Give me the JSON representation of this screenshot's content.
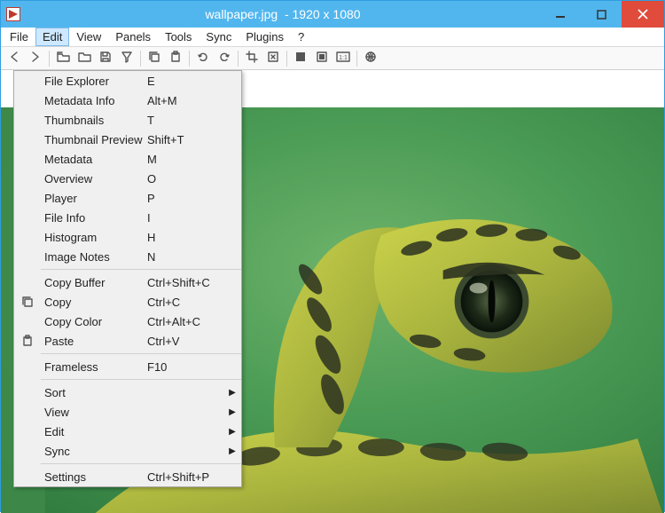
{
  "window": {
    "title": "wallpaper.jpg  - 1920 x 1080"
  },
  "menubar": {
    "items": [
      "File",
      "Edit",
      "View",
      "Panels",
      "Tools",
      "Sync",
      "Plugins",
      "?"
    ],
    "active_index": 1
  },
  "toolbar": {
    "icons": [
      "nav-back-icon",
      "nav-forward-icon",
      "sep",
      "folder-open-icon",
      "folder-icon",
      "save-icon",
      "filter-icon",
      "sep",
      "copy-icon",
      "paste-icon",
      "sep",
      "rotate-ccw-icon",
      "rotate-cw-icon",
      "sep",
      "crop-icon",
      "fit-icon",
      "sep",
      "full-icon",
      "fit-window-icon",
      "one-to-one-icon",
      "sep",
      "globe-icon"
    ]
  },
  "dropdown": {
    "groups": [
      [
        {
          "label": "File Explorer",
          "shortcut": "E",
          "icon": null,
          "submenu": false
        },
        {
          "label": "Metadata Info",
          "shortcut": "Alt+M",
          "icon": null,
          "submenu": false
        },
        {
          "label": "Thumbnails",
          "shortcut": "T",
          "icon": null,
          "submenu": false
        },
        {
          "label": "Thumbnail Preview",
          "shortcut": "Shift+T",
          "icon": null,
          "submenu": false
        },
        {
          "label": "Metadata",
          "shortcut": "M",
          "icon": null,
          "submenu": false
        },
        {
          "label": "Overview",
          "shortcut": "O",
          "icon": null,
          "submenu": false
        },
        {
          "label": "Player",
          "shortcut": "P",
          "icon": null,
          "submenu": false
        },
        {
          "label": "File Info",
          "shortcut": "I",
          "icon": null,
          "submenu": false
        },
        {
          "label": "Histogram",
          "shortcut": "H",
          "icon": null,
          "submenu": false
        },
        {
          "label": "Image Notes",
          "shortcut": "N",
          "icon": null,
          "submenu": false
        }
      ],
      [
        {
          "label": "Copy Buffer",
          "shortcut": "Ctrl+Shift+C",
          "icon": null,
          "submenu": false
        },
        {
          "label": "Copy",
          "shortcut": "Ctrl+C",
          "icon": "copy-icon",
          "submenu": false
        },
        {
          "label": "Copy Color",
          "shortcut": "Ctrl+Alt+C",
          "icon": null,
          "submenu": false
        },
        {
          "label": "Paste",
          "shortcut": "Ctrl+V",
          "icon": "paste-icon",
          "submenu": false
        }
      ],
      [
        {
          "label": "Frameless",
          "shortcut": "F10",
          "icon": null,
          "submenu": false
        }
      ],
      [
        {
          "label": "Sort",
          "shortcut": "",
          "icon": null,
          "submenu": true
        },
        {
          "label": "View",
          "shortcut": "",
          "icon": null,
          "submenu": true
        },
        {
          "label": "Edit",
          "shortcut": "",
          "icon": null,
          "submenu": true
        },
        {
          "label": "Sync",
          "shortcut": "",
          "icon": null,
          "submenu": true
        }
      ],
      [
        {
          "label": "Settings",
          "shortcut": "Ctrl+Shift+P",
          "icon": null,
          "submenu": false
        }
      ]
    ]
  }
}
